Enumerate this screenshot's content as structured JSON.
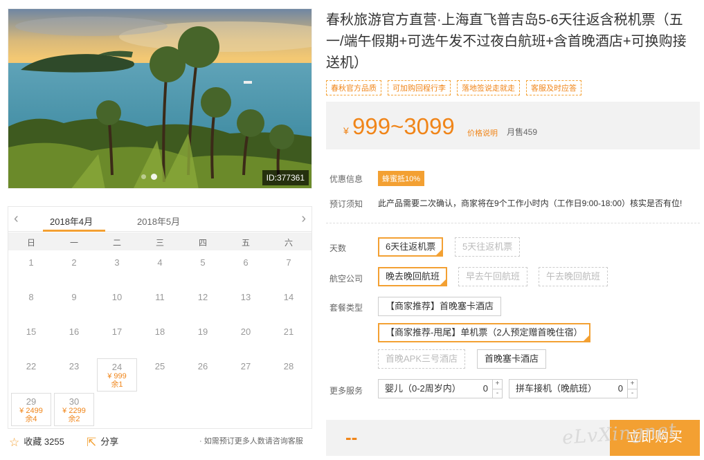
{
  "product": {
    "title": "春秋旅游官方直营·上海直飞普吉岛5-6天往返含税机票（五一/端午假期+可选午发不过夜白航班+含首晚酒店+可换购接送机）",
    "tags": [
      "春秋官方品质",
      "可加购回程行李",
      "落地签说走就走",
      "客服及时应答"
    ],
    "image_id": "ID:377361"
  },
  "price": {
    "currency": "¥",
    "range": "999~3099",
    "explain_label": "价格说明",
    "monthly_sales": "月售459"
  },
  "info": {
    "promo_label": "优惠信息",
    "promo_badge": "蜂蜜抵10%",
    "notice_label": "预订须知",
    "notice_text": "此产品需要二次确认，商家将在9个工作小时内（工作日9:00-18:00）核实是否有位!"
  },
  "options": {
    "days_label": "天数",
    "days": [
      {
        "label": "6天往返机票",
        "state": "on"
      },
      {
        "label": "5天往返机票",
        "state": "off"
      }
    ],
    "airline_label": "航空公司",
    "airline": [
      {
        "label": "晚去晚回航班",
        "state": "on"
      },
      {
        "label": "早去午回航班",
        "state": "off"
      },
      {
        "label": "午去晚回航班",
        "state": "off"
      }
    ],
    "package_label": "套餐类型",
    "package": [
      {
        "label": "【商家推荐】首晚塞卡酒店",
        "state": "normal"
      },
      {
        "label": "【商家推荐-甩尾】单机票（2人预定赠首晚住宿）",
        "state": "on"
      },
      {
        "label": "首晚APK三号酒店",
        "state": "off"
      },
      {
        "label": "首晚塞卡酒店",
        "state": "normal"
      }
    ],
    "more_label": "更多服务",
    "services": [
      {
        "label": "婴儿（0-2周岁内）",
        "qty": "0"
      },
      {
        "label": "拼车接机（晚航班）",
        "qty": "0"
      }
    ]
  },
  "calendar": {
    "prev_icon": "chevron-left-icon",
    "next_icon": "chevron-right-icon",
    "months": [
      "2018年4月",
      "2018年5月"
    ],
    "weekdays": [
      "日",
      "一",
      "二",
      "三",
      "四",
      "五",
      "六"
    ],
    "days": [
      {
        "n": "1"
      },
      {
        "n": "2"
      },
      {
        "n": "3"
      },
      {
        "n": "4"
      },
      {
        "n": "5"
      },
      {
        "n": "6"
      },
      {
        "n": "7"
      },
      {
        "n": "8"
      },
      {
        "n": "9"
      },
      {
        "n": "10"
      },
      {
        "n": "11"
      },
      {
        "n": "12"
      },
      {
        "n": "13"
      },
      {
        "n": "14"
      },
      {
        "n": "15"
      },
      {
        "n": "16"
      },
      {
        "n": "17"
      },
      {
        "n": "18"
      },
      {
        "n": "19"
      },
      {
        "n": "20"
      },
      {
        "n": "21"
      },
      {
        "n": "22"
      },
      {
        "n": "23"
      },
      {
        "n": "24",
        "price": "¥ 999",
        "left": "余1"
      },
      {
        "n": "25"
      },
      {
        "n": "26"
      },
      {
        "n": "27"
      },
      {
        "n": "28"
      },
      {
        "n": "29",
        "price": "¥ 2499",
        "left": "余4"
      },
      {
        "n": "30",
        "price": "¥ 2299",
        "left": "余2"
      }
    ]
  },
  "footer": {
    "fav_icon": "star-icon",
    "fav_label": "收藏",
    "fav_count": "3255",
    "share_icon": "share-icon",
    "share_label": "分享",
    "consult": "· 如需预订更多人数请咨询客服",
    "total": "--",
    "buy_label": "立即购买",
    "watermark": "eLvXingnet"
  },
  "colors": {
    "accent": "#f3a032",
    "accent_text": "#f08519",
    "panel": "#f2f2f2"
  }
}
